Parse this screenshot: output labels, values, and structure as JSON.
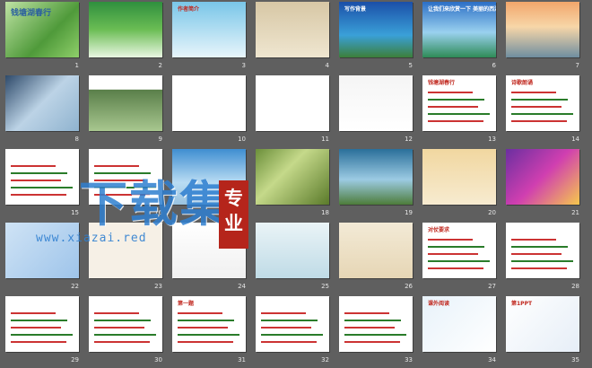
{
  "slides": [
    {
      "num": "1",
      "title": "钱塘湖春行"
    },
    {
      "num": "2",
      "title": ""
    },
    {
      "num": "3",
      "title": "作者简介"
    },
    {
      "num": "4",
      "title": ""
    },
    {
      "num": "5",
      "title": "写作背景"
    },
    {
      "num": "6",
      "title": "让我们来欣赏一下 美丽的西湖"
    },
    {
      "num": "7",
      "title": ""
    },
    {
      "num": "8",
      "title": ""
    },
    {
      "num": "9",
      "title": ""
    },
    {
      "num": "10",
      "title": ""
    },
    {
      "num": "11",
      "title": ""
    },
    {
      "num": "12",
      "title": ""
    },
    {
      "num": "13",
      "title": "钱塘湖春行"
    },
    {
      "num": "14",
      "title": "诗歌朗诵"
    },
    {
      "num": "15",
      "title": ""
    },
    {
      "num": "16",
      "title": ""
    },
    {
      "num": "17",
      "title": ""
    },
    {
      "num": "18",
      "title": ""
    },
    {
      "num": "19",
      "title": ""
    },
    {
      "num": "20",
      "title": ""
    },
    {
      "num": "21",
      "title": ""
    },
    {
      "num": "22",
      "title": ""
    },
    {
      "num": "23",
      "title": ""
    },
    {
      "num": "24",
      "title": ""
    },
    {
      "num": "25",
      "title": ""
    },
    {
      "num": "26",
      "title": ""
    },
    {
      "num": "27",
      "title": "对仗要求"
    },
    {
      "num": "28",
      "title": ""
    },
    {
      "num": "29",
      "title": ""
    },
    {
      "num": "30",
      "title": ""
    },
    {
      "num": "31",
      "title": "第一题"
    },
    {
      "num": "32",
      "title": ""
    },
    {
      "num": "33",
      "title": ""
    },
    {
      "num": "34",
      "title": "课外阅读"
    },
    {
      "num": "35",
      "title": "第1PPT"
    }
  ],
  "watermark": {
    "brand": "下载集",
    "badge": "专业",
    "url": "www.xiazai.red"
  }
}
